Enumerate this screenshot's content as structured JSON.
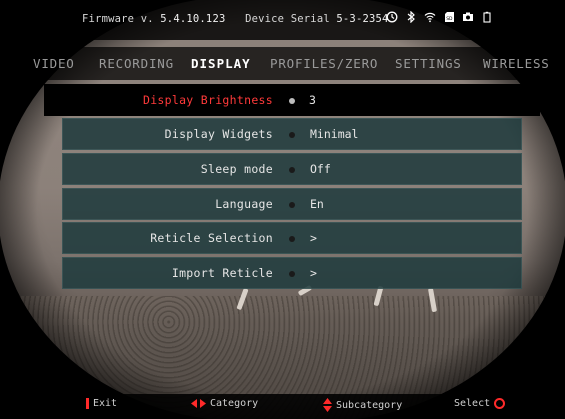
{
  "header": {
    "firmware_label": "Firmware v.",
    "firmware_value": "5.4.10.123",
    "serial_label": "Device Serial",
    "serial_value": "5-3-2354",
    "status_icons": [
      "timer-icon",
      "bluetooth-icon",
      "wifi-icon",
      "sd-card-icon",
      "camera-icon",
      "battery-icon"
    ]
  },
  "tabs": [
    {
      "label": "VIDEO",
      "active": false
    },
    {
      "label": "RECORDING",
      "active": false
    },
    {
      "label": "DISPLAY",
      "active": true
    },
    {
      "label": "PROFILES/ZERO",
      "active": false
    },
    {
      "label": "SETTINGS",
      "active": false
    },
    {
      "label": "WIRELESS",
      "active": false
    }
  ],
  "menu": [
    {
      "label": "Display Brightness",
      "value": "3",
      "selected": true
    },
    {
      "label": "Display Widgets",
      "value": "Minimal",
      "selected": false
    },
    {
      "label": "Sleep mode",
      "value": "Off",
      "selected": false
    },
    {
      "label": "Language",
      "value": "En",
      "selected": false
    },
    {
      "label": "Reticle Selection",
      "value": ">",
      "selected": false
    },
    {
      "label": "Import Reticle",
      "value": ">",
      "selected": false
    }
  ],
  "footer": {
    "exit": "Exit",
    "category": "Category",
    "subcategory": "Subcategory",
    "select": "Select"
  },
  "colors": {
    "accent_red": "#ff3a3a",
    "menu_bg": "#1e3a3c"
  }
}
